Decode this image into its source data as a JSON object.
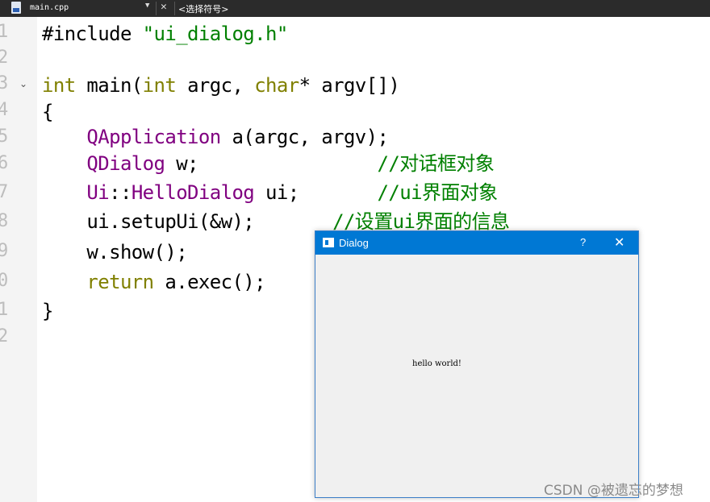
{
  "tabbar": {
    "filename": "main.cpp",
    "dropdown": "▼",
    "close": "✕",
    "symbol_selector": "<选择符号>"
  },
  "gutter": {
    "line_numbers": [
      "1",
      "2",
      "3",
      "4",
      "5",
      "6",
      "7",
      "8",
      "9",
      "0",
      "1",
      "2"
    ],
    "fold_marker": "⌄"
  },
  "code": {
    "line1": {
      "directive": "#include",
      "space": " ",
      "path": "\"ui_dialog.h\""
    },
    "line3": {
      "int1": "int",
      "main": " main(",
      "int2": "int",
      "argc": " argc, ",
      "char": "char",
      "rest": "* argv[])"
    },
    "line4": "{",
    "line5": {
      "type": "QApplication",
      "rest": " a(argc, argv);"
    },
    "line6": {
      "type": "QDialog",
      "rest": " w;",
      "pad": "                ",
      "comment": "//对话框对象"
    },
    "line7": {
      "ns": "Ui",
      "sep": "::",
      "type": "HelloDialog",
      "rest": " ui;",
      "pad": "       ",
      "comment": "//ui界面对象"
    },
    "line8": {
      "code": "ui.setupUi(&w);",
      "pad": "       ",
      "comment": "//设置ui界面的信息"
    },
    "line9": "w.show();",
    "line10": {
      "kw": "return",
      "rest": " a.exec();"
    },
    "line11": "}"
  },
  "dialog": {
    "title": "Dialog",
    "help": "?",
    "close": "✕",
    "label": "hello world!"
  },
  "watermark": "CSDN @被遗忘的梦想",
  "colors": {
    "keyword": "#808000",
    "type": "#800080",
    "string": "#008000",
    "comment": "#008000",
    "titlebar": "#0078d4"
  }
}
